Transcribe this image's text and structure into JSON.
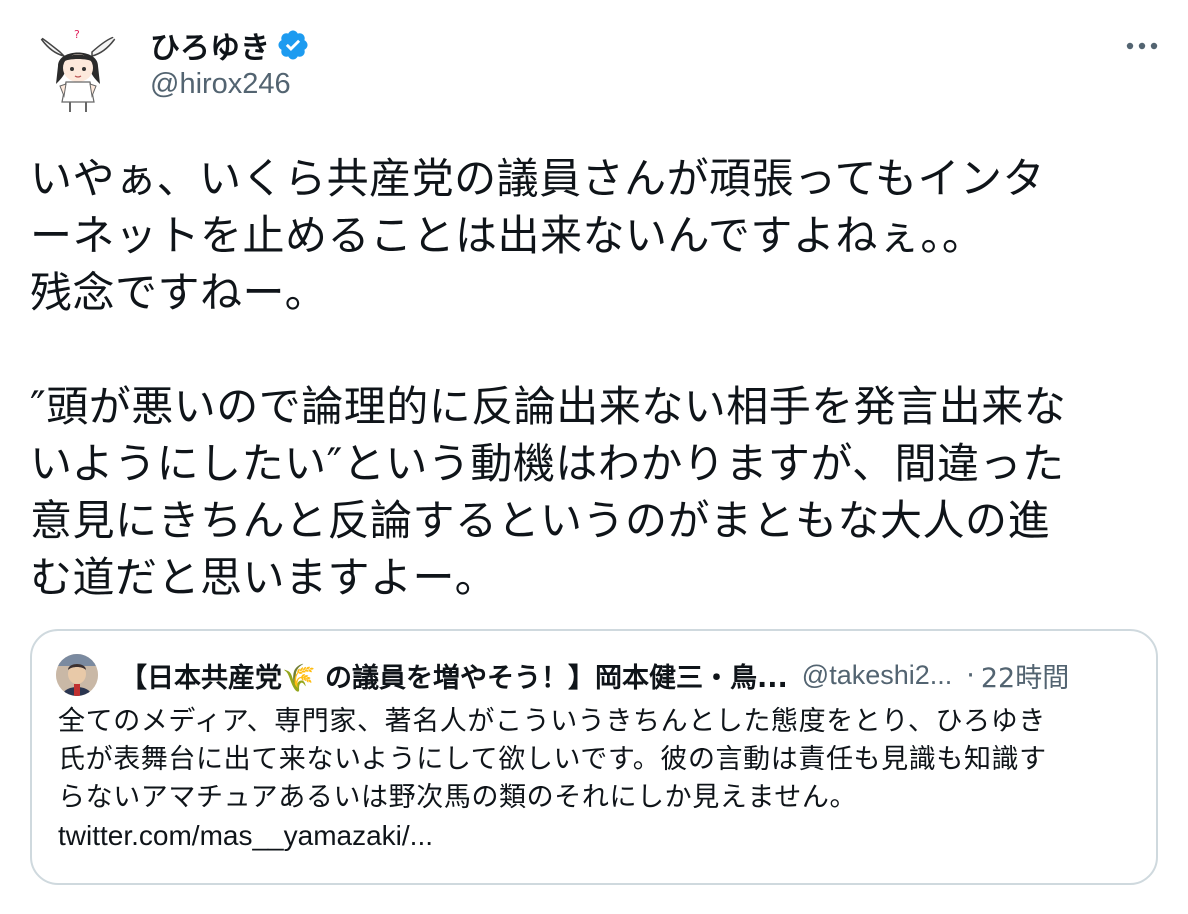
{
  "author": {
    "display_name": "ひろゆき",
    "handle": "@hirox246",
    "verified": true,
    "avatar_icon": "anime-character-avatar-icon",
    "verified_icon": "verified-badge-icon",
    "verified_color": "#1d9bf0"
  },
  "menu": {
    "more_icon": "more-horizontal-icon"
  },
  "tweet": {
    "paragraph1_lines": [
      "いやぁ、いくら共産党の議員さんが頑張ってもインタ",
      "ーネットを止めることは出来ないんですよねぇ。。",
      "残念ですねー。"
    ],
    "paragraph2_lines": [
      "″頭が悪いので論理的に反論出来ない相手を発言出来な",
      "いようにしたい″という動機はわかりますが、間違った",
      "意見にきちんと反論するというのがまともな大人の進",
      "む道だと思いますよー。"
    ]
  },
  "quoted_tweet": {
    "avatar_icon": "quoted-author-avatar-icon",
    "display_name": "【日本共産党🌾 の議員を増やそう！】岡本健三・鳥...",
    "handle": "@takeshi2...",
    "separator": "·",
    "time": "22時間",
    "body_lines": [
      "全てのメディア、専門家、著名人がこういうきちんとした態度をとり、ひろゆき",
      "氏が表舞台に出て来ないようにして欲しいです。彼の言動は責任も見識も知識す",
      "らないアマチュアあるいは野次馬の類のそれにしか見えません。"
    ],
    "link": "twitter.com/mas__yamazaki/..."
  },
  "colors": {
    "text": "#0f1419",
    "secondary": "#536471",
    "border": "#cfd9de",
    "accent": "#1d9bf0"
  }
}
